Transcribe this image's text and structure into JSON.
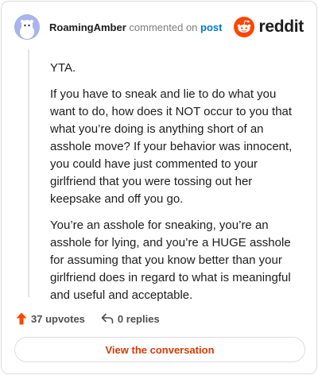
{
  "comment": {
    "author": "RoamingAmber",
    "action_text": "commented on",
    "target_link": "post",
    "paragraphs": [
      "YTA.",
      "If you have to sneak and lie to do what you want to do, how does it NOT occur to you that what you’re doing is anything short of an asshole move? If your behavior was innocent, you could have just commented to your girlfriend that you were tossing out her keepsake and off you go.",
      "You’re an asshole for sneaking, you’re an asshole for lying, and you’re a HUGE asshole for assuming that you know better than your girlfriend does in regard to what is meaningful and useful and acceptable."
    ]
  },
  "brand": {
    "name": "reddit",
    "color": "#ff4500"
  },
  "actions": {
    "upvotes_label": "37 upvotes",
    "replies_label": "0 replies",
    "upvote_color": "#ff4500"
  },
  "footer": {
    "view_button_label": "View the conversation",
    "accent": "#d93a00"
  }
}
